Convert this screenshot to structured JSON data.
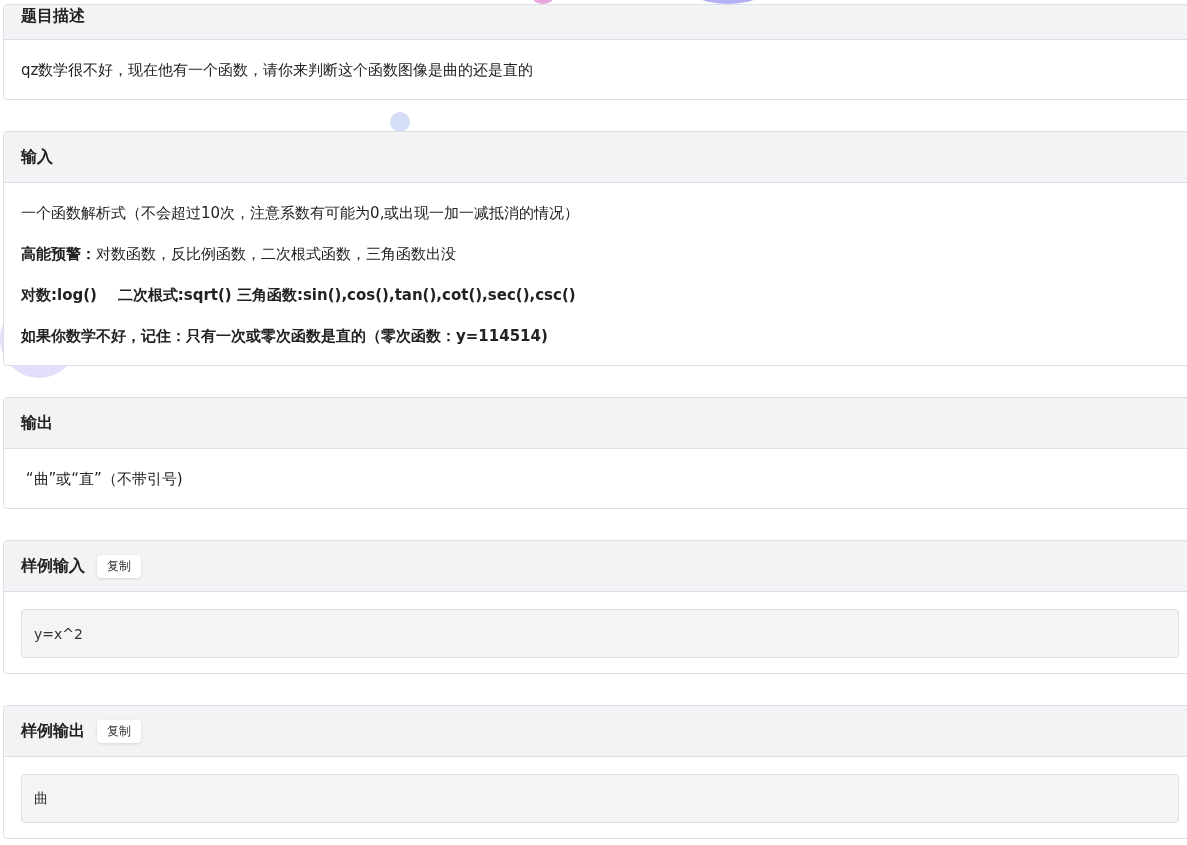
{
  "sections": [
    {
      "kind": "text",
      "title": "题目描述",
      "paragraphs": [
        {
          "text": "qz数学很不好，现在他有一个函数，请你来判断这个函数图像是曲的还是直的",
          "bold": false
        }
      ]
    },
    {
      "kind": "text",
      "title": "输入",
      "paragraphs": [
        {
          "text": "一个函数解析式（不会超过10次，注意系数有可能为0,或出现一加一减抵消的情况）",
          "bold": false
        },
        {
          "text": "**高能预警：**对数函数，反比例函数，二次根式函数，三角函数出没",
          "bold": false
        },
        {
          "text": "对数:log()    二次根式:sqrt() 三角函数:sin(),cos(),tan(),cot(),sec(),csc()",
          "bold": true
        },
        {
          "text": "如果你数学不好，记住：只有一次或零次函数是直的（零次函数：y=114514)",
          "bold": true
        }
      ]
    },
    {
      "kind": "text",
      "title": "输出",
      "paragraphs": [
        {
          "text": " “曲”或“直”（不带引号)",
          "bold": false
        }
      ]
    },
    {
      "kind": "sample",
      "title": "样例输入",
      "copy_label": "复制",
      "code": "y=x^2"
    },
    {
      "kind": "sample",
      "title": "样例输出",
      "copy_label": "复制",
      "code": "曲"
    }
  ]
}
